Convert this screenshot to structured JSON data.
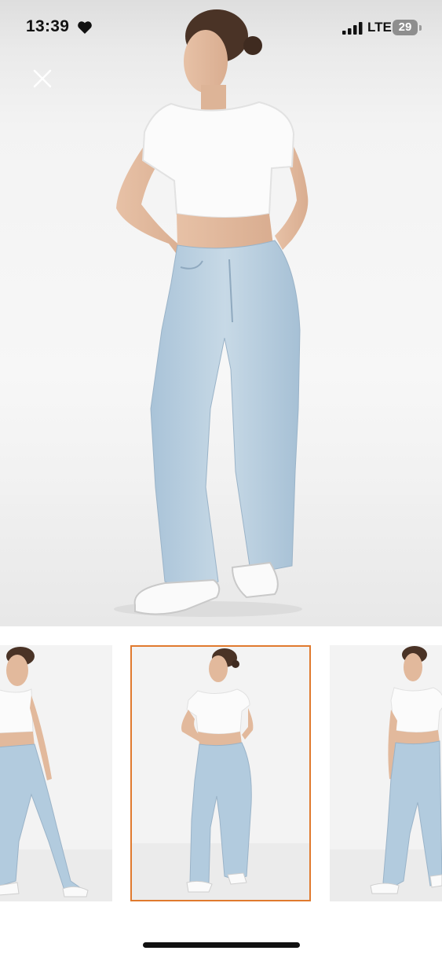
{
  "status_bar": {
    "time": "13:39",
    "network": "LTE",
    "battery_level": "29",
    "icons": [
      "heart-icon",
      "signal-icon",
      "battery-icon"
    ]
  },
  "viewer": {
    "close_icon": "close-icon",
    "selected_thumbnail_index": 1,
    "selected_border_color": "#e07a2e"
  },
  "thumbnails": [
    {
      "pose": "facing-front-left"
    },
    {
      "pose": "looking-away"
    },
    {
      "pose": "facing-front-right"
    }
  ]
}
